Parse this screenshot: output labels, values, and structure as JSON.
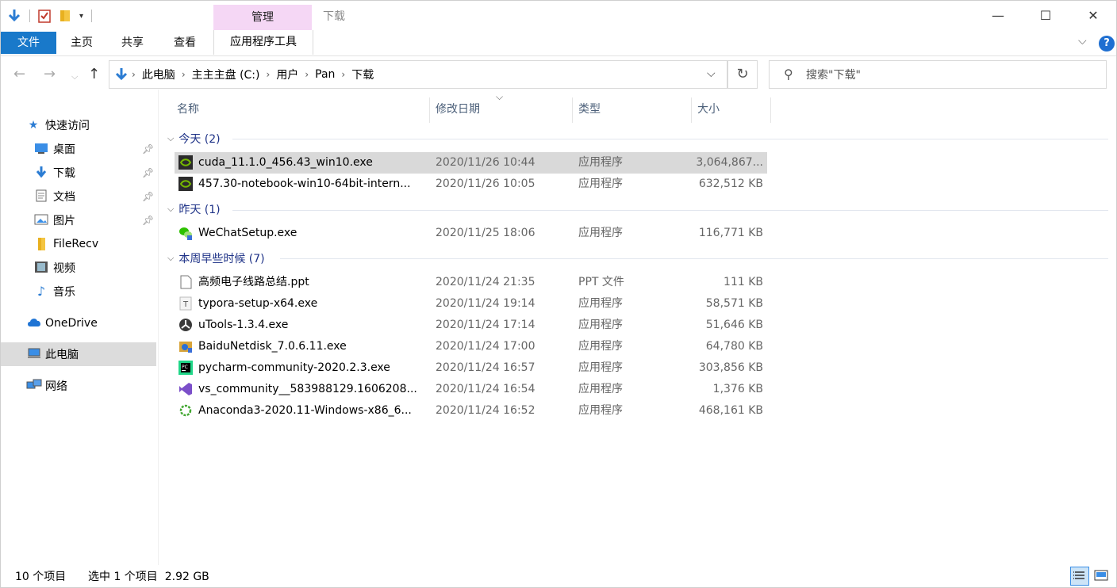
{
  "titlebar": {
    "context_tab": "管理",
    "title": "下载",
    "buttons": {
      "minimize": "—",
      "maximize": "☐",
      "close": "✕"
    }
  },
  "ribbon": {
    "file": "文件",
    "home": "主页",
    "share": "共享",
    "view": "查看",
    "app_tools": "应用程序工具",
    "help": "?"
  },
  "address": {
    "crumbs": [
      "此电脑",
      "主主主盘 (C:)",
      "用户",
      "Pan",
      "下载"
    ]
  },
  "search": {
    "placeholder": "搜索\"下载\""
  },
  "navpane": {
    "quick_access": "快速访问",
    "items": [
      "桌面",
      "下载",
      "文档",
      "图片",
      "FileRecv",
      "视频",
      "音乐"
    ],
    "onedrive": "OneDrive",
    "this_pc": "此电脑",
    "network": "网络"
  },
  "columns": {
    "name": "名称",
    "date": "修改日期",
    "type": "类型",
    "size": "大小"
  },
  "groups": [
    {
      "label": "今天 (2)"
    },
    {
      "label": "昨天 (1)"
    },
    {
      "label": "本周早些时候 (7)"
    }
  ],
  "files": [
    {
      "name": "cuda_11.1.0_456.43_win10.exe",
      "date": "2020/11/26 10:44",
      "type": "应用程序",
      "size": "3,064,867...",
      "icon": "nvidia-icon",
      "selected": true
    },
    {
      "name": "457.30-notebook-win10-64bit-intern...",
      "date": "2020/11/26 10:05",
      "type": "应用程序",
      "size": "632,512 KB",
      "icon": "nvidia-icon"
    },
    {
      "name": "WeChatSetup.exe",
      "date": "2020/11/25 18:06",
      "type": "应用程序",
      "size": "116,771 KB",
      "icon": "wechat-icon"
    },
    {
      "name": "高频电子线路总结.ppt",
      "date": "2020/11/24 21:35",
      "type": "PPT 文件",
      "size": "111 KB",
      "icon": "document-icon"
    },
    {
      "name": "typora-setup-x64.exe",
      "date": "2020/11/24 19:14",
      "type": "应用程序",
      "size": "58,571 KB",
      "icon": "typora-icon"
    },
    {
      "name": "uTools-1.3.4.exe",
      "date": "2020/11/24 17:14",
      "type": "应用程序",
      "size": "51,646 KB",
      "icon": "utools-icon"
    },
    {
      "name": "BaiduNetdisk_7.0.6.11.exe",
      "date": "2020/11/24 17:00",
      "type": "应用程序",
      "size": "64,780 KB",
      "icon": "baidu-icon"
    },
    {
      "name": "pycharm-community-2020.2.3.exe",
      "date": "2020/11/24 16:57",
      "type": "应用程序",
      "size": "303,856 KB",
      "icon": "pycharm-icon"
    },
    {
      "name": "vs_community__583988129.1606208...",
      "date": "2020/11/24 16:54",
      "type": "应用程序",
      "size": "1,376 KB",
      "icon": "visual-studio-icon"
    },
    {
      "name": "Anaconda3-2020.11-Windows-x86_6...",
      "date": "2020/11/24 16:52",
      "type": "应用程序",
      "size": "468,161 KB",
      "icon": "anaconda-icon"
    }
  ],
  "status": {
    "count": "10 个项目",
    "selection": "选中 1 个项目  2.92 GB"
  },
  "colors": {
    "accent": "#1979ca",
    "context_tab": "#f5d7f5",
    "group_text": "#1e3287"
  }
}
